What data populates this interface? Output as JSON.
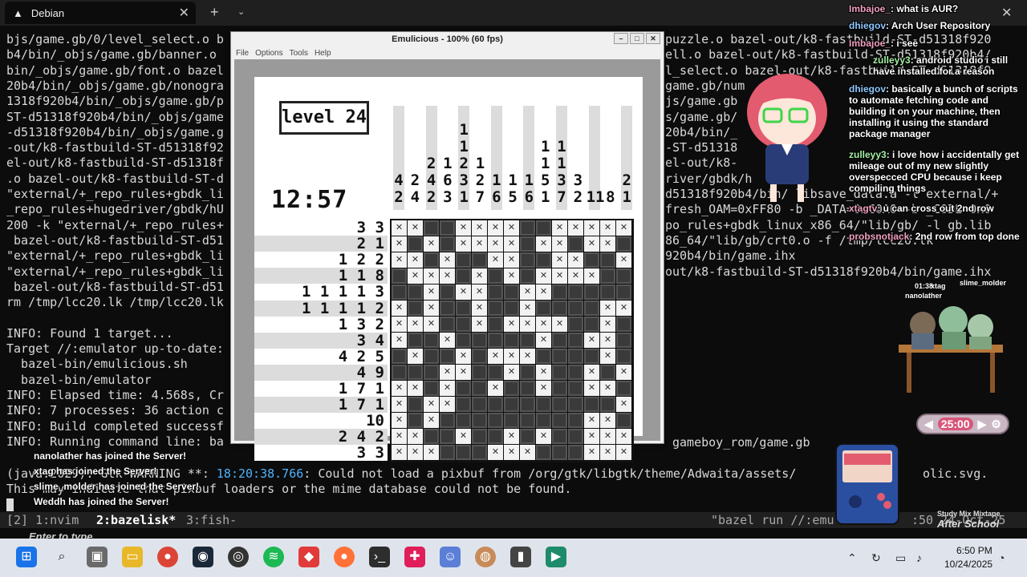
{
  "terminal_window": {
    "tab_title": "Debian",
    "new_tab": "+",
    "tab_menu": "⌄",
    "close": "✕"
  },
  "terminal": {
    "left_lines": [
      "bjs/game.gb/0/level_select.o b",
      "b4/bin/_objs/game.gb/banner.o",
      "bin/_objs/game.gb/font.o bazel",
      "20b4/bin/_objs/game.gb/nonogra",
      "1318f920b4/bin/_objs/game.gb/p",
      "ST-d51318f920b4/bin/_objs/game",
      "-d51318f920b4/bin/_objs/game.g",
      "-out/k8-fastbuild-ST-d51318f92",
      "el-out/k8-fastbuild-ST-d51318f",
      ".o bazel-out/k8-fastbuild-ST-d",
      "\"external/+_repo_rules+gbdk_li",
      "_repo_rules+hugedriver/gbdk/hU",
      "200 -k \"external/+_repo_rules+",
      " bazel-out/k8-fastbuild-ST-d51",
      "\"external/+_repo_rules+gbdk_li",
      "\"external/+_repo_rules+gbdk_li",
      " bazel-out/k8-fastbuild-ST-d51",
      "rm /tmp/lcc20.lk /tmp/lcc20.lk",
      "",
      "INFO: Found 1 target...",
      "Target //:emulator up-to-date:",
      "  bazel-bin/emulicious.sh",
      "  bazel-bin/emulator",
      "INFO: Elapsed time: 4.568s, Cr",
      "INFO: 7 processes: 36 action c",
      "INFO: Build completed successf",
      "INFO: Running command line: ba"
    ],
    "right_lines": [
      "puzzle.o bazel-out/k8-fastbuild-ST-d51318f920",
      "ell.o bazel-out/k8-fastbuild-ST-d51318f920b4/",
      "l_select.o bazel-out/k8-fastbuild-ST-d51318f9",
      "game.gb/num",
      "js/game.gb",
      "s/game.gb/",
      "20b4/bin/_",
      "-ST-d51318",
      "el-out/k8-",
      "river/gbdk/h",
      "d51318f920b4/bin/ libsave_data.a -l external/+",
      "fresh_OAM=0xFF80 -b _DATA=0xC0A0 -b _CODE=0x0",
      "po_rules+gbdk_linux_x86_64/\"lib/gb/ -l gb.lib",
      "86_64/\"lib/gb/crt0.o -f /tmp/lcc20.lk",
      "920b4/bin/game.ihx",
      "out/k8-fastbuild-ST-d51318f920b4/bin/game.ihx"
    ],
    "run_line_tail": "gameboy_rom/game.gb",
    "warning_prefix": "(java:2029): Gtk-WARNING **: ",
    "warning_time": "18:20:38.766",
    "warning_rest": ": Could not load a pixbuf from /org/gtk/libgtk/theme/Adwaita/assets/",
    "warning_tail": "olic.svg.",
    "warning_line2": "This may indicate that pixbuf loaders or the mime database could not be found."
  },
  "tmux": {
    "win1": "[2] 1:nvim",
    "win2": "2:bazelisk*",
    "win3": "3:fish-",
    "right": "\"bazel run //:emu",
    "right2": ":50 24-Oct-25"
  },
  "server_joins": [
    "nanolather has joined the Server!",
    "xtag has joined the Server!",
    "slime_molder has joined the Server!",
    "Weddh has joined the Server!"
  ],
  "enter_hint": "Enter to type...",
  "emulator": {
    "title": "Emulicious - 100% (60 fps)",
    "menu": [
      "File",
      "Options",
      "Tools",
      "Help"
    ],
    "level_label": "level 24",
    "timer": "12:57",
    "column_clues": [
      "\n\n\n4\n2",
      "\n\n\n2\n4",
      "\n\n2\n4\n2",
      "\n\n1\n6\n3",
      "1\n1\n2\n3\n1",
      "\n\n1\n2\n7",
      "\n\n\n1\n6",
      "\n\n\n1\n5",
      "\n\n\n1\n6",
      "\n1\n1\n5\n1",
      "\n1\n1\n3\n7",
      "\n\n\n3\n2",
      "\n\n\n\n11",
      "\n\n\n\n8",
      "\n\n\n2\n1"
    ],
    "row_clues": [
      "3 3",
      "2 1",
      "1 2 2",
      "1 1 8",
      "1 1 1 1 3",
      "1 1 1 1 2",
      "1 3 2",
      "3 4",
      "4 2 5",
      "4 9",
      "1 7 1",
      "1 7 1",
      "10",
      "2 4 2",
      "3 3"
    ],
    "grid": [
      "xx..xxxx..xxxxx",
      "x.x.xxxx.xx.xx.",
      "xx.x..xx..xx..x",
      ".xxx.x.x.xxxx..",
      "..x.xx..xx.....",
      "x.x..x..x....xx",
      "xxx..x.xxxx..x.",
      "x..x.....x..xx.",
      ".x..x.xxx....x.",
      "...xx..x.x..x.x",
      "xx.x..x..x..xx.",
      "x.xx..........x",
      "x.x.........xx.",
      "xx..x..x.x..xxx",
      "xxx...xxx...xxx"
    ]
  },
  "chat": [
    {
      "nick": "Imbajoe_",
      "text": ": what is AUR?"
    },
    {
      "nick": "dhiegov",
      "text": ": Arch User Repository"
    },
    {
      "nick": "Imbajoe_",
      "text": ": i see"
    },
    {
      "nick": "zulleyy3",
      "text": ": android studio i still have installed for a reason"
    },
    {
      "nick": "dhiegov",
      "text": ": basically a bunch of scripts to automate fetching code and building it on your machine, then installing it using the standard package manager"
    },
    {
      "nick": "zulleyy3",
      "text": ": i love how i accidentally get mileage out of my new slightly overspecced CPU because i keep compiling things"
    },
    {
      "nick": "xtagtv",
      "text": ": u can cross out 2nd row"
    },
    {
      "nick": "probsnotjack",
      "text": ": 2nd row from top done"
    }
  ],
  "scene_labels": {
    "time": "01:38",
    "xtag": "xtag",
    "slime": "slime_molder",
    "nanolather": "nanolather"
  },
  "pomodoro": {
    "time": "25:00"
  },
  "mixtape": "Study Mix Mixtape",
  "after_school": "After School",
  "taskbar": {
    "time": "6:50 PM",
    "date": "10/24/2025"
  }
}
